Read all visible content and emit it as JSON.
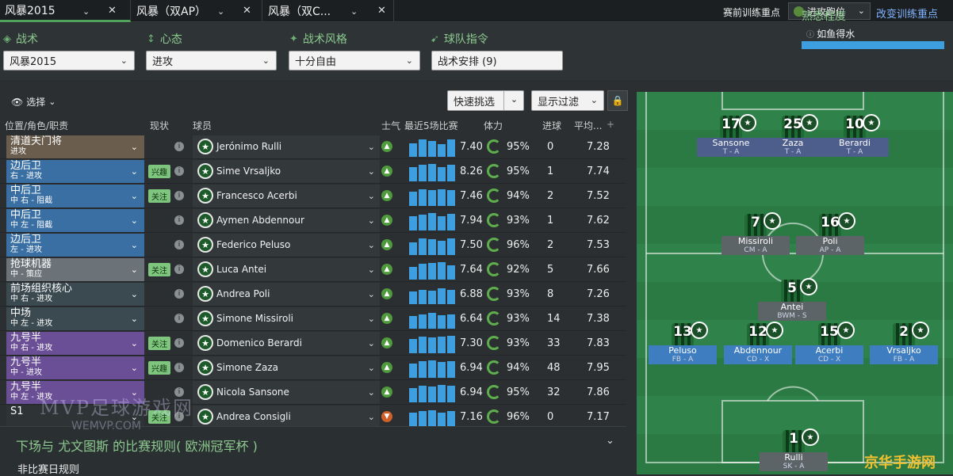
{
  "tabs": [
    {
      "label": "风暴2015"
    },
    {
      "label": "风暴（双AP）"
    },
    {
      "label": "风暴（双C..."
    }
  ],
  "top": {
    "train_focus_label": "赛前训练重点",
    "train_focus_value": "进攻跑位",
    "change_training": "改变训练重点"
  },
  "header": {
    "tactic_label": "战术",
    "tactic_value": "风暴2015",
    "mentality_label": "心态",
    "mentality_value": "进攻",
    "style_label": "战术风格",
    "style_value": "十分自由",
    "instructions_label": "球队指令",
    "instructions_value": "战术安排 (9)",
    "familiarity_label": "熟悉程度",
    "familiarity_value": "如鱼得水",
    "familiarity_level": 1.0
  },
  "toolbar": {
    "select_label": "选择",
    "quick_pick": "快速挑选",
    "display_filter": "显示过滤"
  },
  "columns": {
    "position": "位置/角色/职责",
    "status": "现状",
    "player": "球员",
    "morale": "士气",
    "last5": "最近5场比赛",
    "condition": "体力",
    "goals": "进球",
    "avg": "平均..."
  },
  "rows": [
    {
      "role": "清道夫门将",
      "duty": "进攻",
      "color": "#6a5d4e",
      "badge": "",
      "player": "Jerónimo Rulli",
      "morale": "▲",
      "form": [
        0.75,
        0.95,
        0.85,
        0.7,
        0.95
      ],
      "rating": "7.40",
      "condition": "95%",
      "goals": "0",
      "avg": "7.28"
    },
    {
      "role": "边后卫",
      "duty": "右 - 进攻",
      "color": "#3a6fa3",
      "badge": "兴趣",
      "player": "Sime Vrsaljko",
      "morale": "▲",
      "form": [
        0.8,
        0.9,
        0.95,
        0.8,
        0.9
      ],
      "rating": "8.26",
      "condition": "95%",
      "goals": "1",
      "avg": "7.74"
    },
    {
      "role": "中后卫",
      "duty": "中 右 - 阻截",
      "color": "#3a6fa3",
      "badge": "关注",
      "player": "Francesco Acerbi",
      "morale": "▲",
      "form": [
        0.8,
        0.9,
        0.85,
        0.9,
        0.85
      ],
      "rating": "7.46",
      "condition": "94%",
      "goals": "2",
      "avg": "7.52"
    },
    {
      "role": "中后卫",
      "duty": "中 左 - 阻截",
      "color": "#3a6fa3",
      "badge": "",
      "player": "Aymen Abdennour",
      "morale": "▲",
      "form": [
        0.8,
        0.85,
        0.95,
        0.8,
        0.9
      ],
      "rating": "7.94",
      "condition": "93%",
      "goals": "1",
      "avg": "7.62"
    },
    {
      "role": "边后卫",
      "duty": "左 - 进攻",
      "color": "#3a6fa3",
      "badge": "",
      "player": "Federico Peluso",
      "morale": "▲",
      "form": [
        0.7,
        0.9,
        0.85,
        0.8,
        0.9
      ],
      "rating": "7.50",
      "condition": "96%",
      "goals": "2",
      "avg": "7.53"
    },
    {
      "role": "抢球机器",
      "duty": "中 - 策应",
      "color": "#6b7378",
      "badge": "关注",
      "player": "Luca Antei",
      "morale": "▲",
      "form": [
        0.7,
        0.85,
        0.9,
        0.95,
        0.8
      ],
      "rating": "7.64",
      "condition": "92%",
      "goals": "5",
      "avg": "7.66"
    },
    {
      "role": "前场组织核心",
      "duty": "中 右 - 进攻",
      "color": "#3b4a50",
      "badge": "",
      "player": "Andrea Poli",
      "morale": "▲",
      "form": [
        0.7,
        0.8,
        0.75,
        0.85,
        0.8
      ],
      "rating": "6.88",
      "condition": "93%",
      "goals": "8",
      "avg": "7.26"
    },
    {
      "role": "中场",
      "duty": "中 左 - 进攻",
      "color": "#3b4a50",
      "badge": "",
      "player": "Simone Missiroli",
      "morale": "▲",
      "form": [
        0.7,
        0.8,
        0.85,
        0.75,
        0.8
      ],
      "rating": "6.64",
      "condition": "93%",
      "goals": "14",
      "avg": "7.38"
    },
    {
      "role": "九号半",
      "duty": "中 右 - 进攻",
      "color": "#6a4f96",
      "badge": "关注",
      "player": "Domenico Berardi",
      "morale": "▲",
      "form": [
        0.8,
        0.9,
        0.85,
        0.9,
        0.95
      ],
      "rating": "7.30",
      "condition": "93%",
      "goals": "33",
      "avg": "7.83"
    },
    {
      "role": "九号半",
      "duty": "中 - 进攻",
      "color": "#6a4f96",
      "badge": "兴趣",
      "player": "Simone Zaza",
      "morale": "▲",
      "form": [
        0.8,
        0.9,
        0.95,
        0.85,
        0.9
      ],
      "rating": "6.94",
      "condition": "94%",
      "goals": "48",
      "avg": "7.95"
    },
    {
      "role": "九号半",
      "duty": "中 左 - 进攻",
      "color": "#6a4f96",
      "badge": "",
      "player": "Nicola Sansone",
      "morale": "▲",
      "form": [
        0.8,
        0.9,
        0.85,
        0.95,
        0.9
      ],
      "rating": "6.94",
      "condition": "95%",
      "goals": "32",
      "avg": "7.86"
    },
    {
      "role": "S1",
      "duty": "",
      "color": "#2e3336",
      "badge": "关注",
      "player": "Andrea Consigli",
      "morale": "▼",
      "form": [
        0.8,
        0.85,
        0.9,
        0.8,
        0.85
      ],
      "rating": "7.16",
      "condition": "96%",
      "goals": "0",
      "avg": "7.17"
    }
  ],
  "rules": {
    "title": "下场与 尤文图斯 的比赛规则( 欧洲冠军杯 )",
    "subtitle": "非比赛日规则"
  },
  "pitch": [
    {
      "num": "17",
      "name": "Sansone",
      "role": "T - A",
      "cls": ""
    },
    {
      "num": "25",
      "name": "Zaza",
      "role": "T - A",
      "cls": ""
    },
    {
      "num": "10",
      "name": "Berardi",
      "role": "T - A",
      "cls": ""
    },
    {
      "num": "7",
      "name": "Missiroli",
      "role": "CM - A",
      "cls": "mid"
    },
    {
      "num": "16",
      "name": "Poli",
      "role": "AP - A",
      "cls": "mid"
    },
    {
      "num": "5",
      "name": "Antei",
      "role": "BWM - S",
      "cls": "mid"
    },
    {
      "num": "13",
      "name": "Peluso",
      "role": "FB - A",
      "cls": "def"
    },
    {
      "num": "12",
      "name": "Abdennour",
      "role": "CD - X",
      "cls": "def"
    },
    {
      "num": "15",
      "name": "Acerbi",
      "role": "CD - X",
      "cls": "def"
    },
    {
      "num": "2",
      "name": "Vrsaljko",
      "role": "FB - A",
      "cls": "def"
    },
    {
      "num": "1",
      "name": "Rulli",
      "role": "SK - A",
      "cls": "gk"
    }
  ],
  "watermarks": {
    "w1": "MVP足球游戏网",
    "w2": "WEMVP.COM",
    "w3": "京华手游网"
  }
}
